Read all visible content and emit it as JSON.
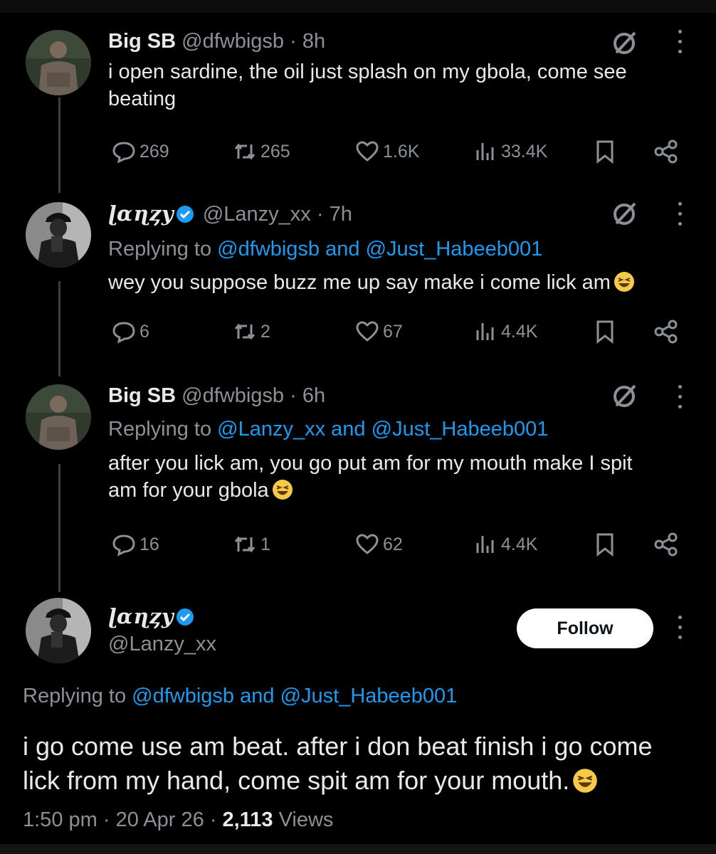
{
  "colors": {
    "background": "#000000",
    "text": "#e7e9ea",
    "muted": "#8b9196",
    "link": "#1d9bf0",
    "verified": "#1d9bf0",
    "follow_bg": "#ffffff"
  },
  "tweets": [
    {
      "name": "Big SB",
      "handle": "@dfwbigsb",
      "dot": "·",
      "time": "8h",
      "text": "i open sardine, the oil just splash on my gbola, come see beating",
      "replies": "269",
      "retweets": "265",
      "likes": "1.6K",
      "views": "33.4K"
    },
    {
      "name": "ɭɑɳȥy",
      "verified": true,
      "handle": "@Lanzy_xx",
      "dot": "·",
      "time": "7h",
      "replying_prefix": "Replying to",
      "replying_user1": "@dfwbigsb",
      "replying_and": "and",
      "replying_user2": "@Just_Habeeb001",
      "text": "wey you suppose buzz me up say make i come lick am",
      "emoji": "laughing-face-emoji",
      "replies": "6",
      "retweets": "2",
      "likes": "67",
      "views": "4.4K"
    },
    {
      "name": "Big SB",
      "handle": "@dfwbigsb",
      "dot": "·",
      "time": "6h",
      "replying_prefix": "Replying to",
      "replying_user1": "@Lanzy_xx",
      "replying_and": "and",
      "replying_user2": "@Just_Habeeb001",
      "text_line1": "after you lick am, you go put am for my mouth make I spit",
      "text_line2": "am for your gbola",
      "emoji": "laughing-face-emoji",
      "replies": "16",
      "retweets": "1",
      "likes": "62",
      "views": "4.4K"
    }
  ],
  "main_tweet": {
    "name": "ɭɑɳȥy",
    "verified": true,
    "handle": "@Lanzy_xx",
    "follow_label": "Follow",
    "replying_prefix": "Replying to",
    "replying_user1": "@dfwbigsb",
    "replying_and": "and",
    "replying_user2": "@Just_Habeeb001",
    "text_line1": "i go come use am beat. after i don beat finish i go come",
    "text_line2": "lick from my hand, come spit am for your mouth.",
    "emoji": "laughing-face-emoji",
    "time": "1:50 pm",
    "sep1": "·",
    "date": "20 Apr 26",
    "sep2": "·",
    "views_count": "2,113",
    "views_label": "Views"
  }
}
